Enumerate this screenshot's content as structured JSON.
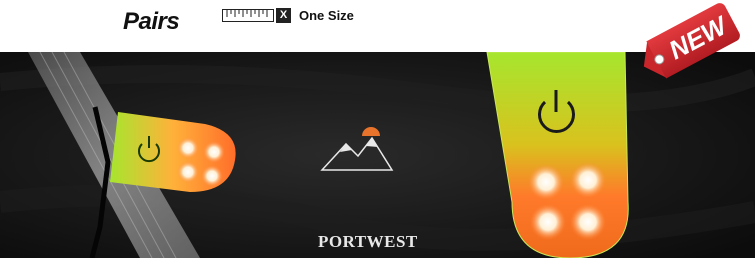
{
  "header": {
    "title": "Pairs",
    "size_badge": "X",
    "size_label": "One Size"
  },
  "photo": {
    "brand": "PORTWEST",
    "tag": "NEW"
  },
  "colors": {
    "fabric": "#141414",
    "light_green": "#9fe02a",
    "light_orange": "#ff7a2a",
    "tag_red": "#d42a30"
  },
  "icons": [
    "ruler-icon",
    "power-icon",
    "mountain-logo-icon",
    "price-tag-icon"
  ]
}
